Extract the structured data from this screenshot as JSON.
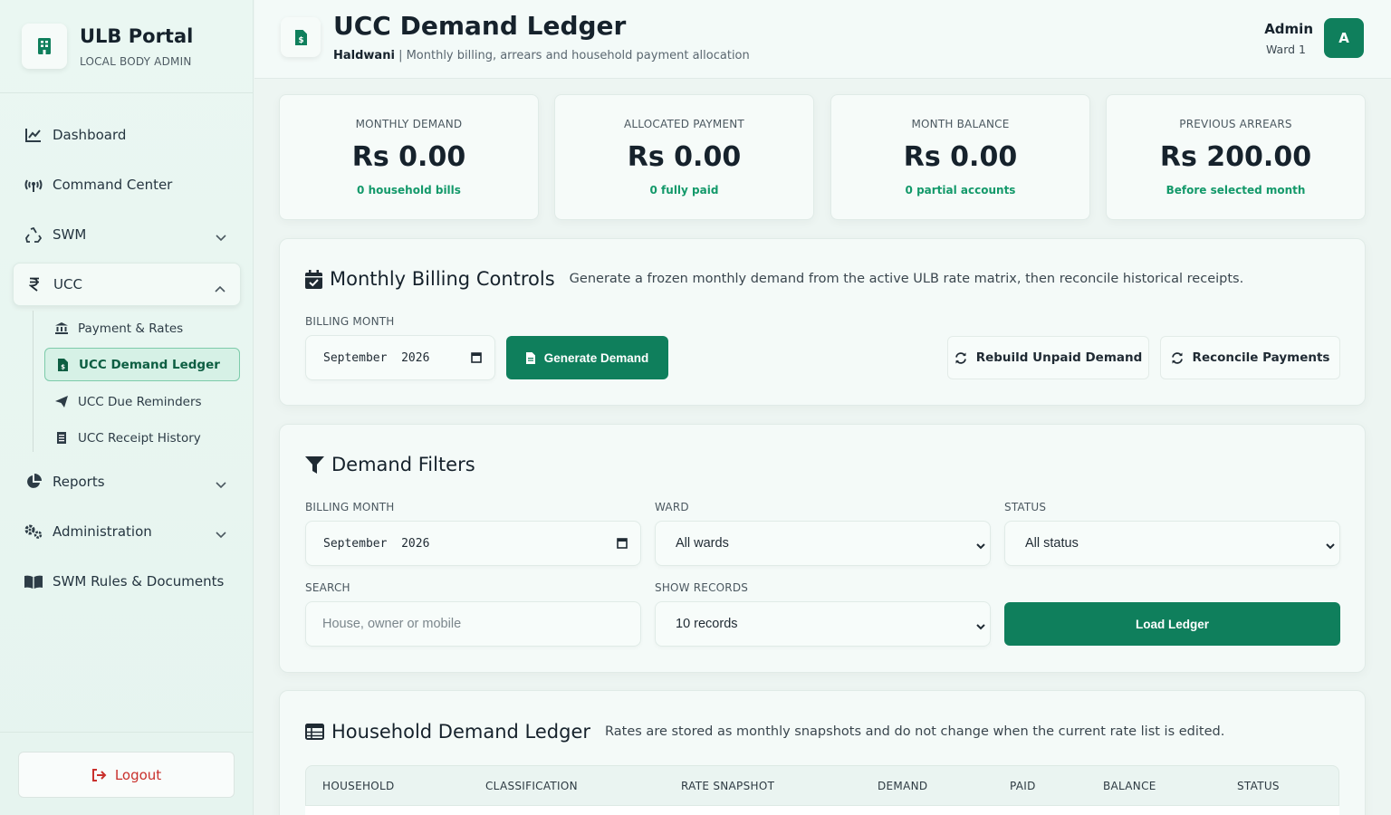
{
  "sidebar": {
    "brand_title": "ULB Portal",
    "brand_subtitle": "LOCAL BODY ADMIN",
    "nav": {
      "dashboard": "Dashboard",
      "command_center": "Command Center",
      "swm": "SWM",
      "ucc": "UCC",
      "reports": "Reports",
      "administration": "Administration",
      "swm_rules": "SWM Rules & Documents"
    },
    "ucc_sub": {
      "payment_rates": "Payment & Rates",
      "demand_ledger": "UCC Demand Ledger",
      "due_reminders": "UCC Due Reminders",
      "receipt_history": "UCC Receipt History"
    },
    "logout": "Logout"
  },
  "header": {
    "title": "UCC Demand Ledger",
    "city": "Haldwani",
    "subtitle": "| Monthly billing, arrears and household payment allocation",
    "user_name": "Admin",
    "user_role": "Ward 1",
    "avatar_letter": "A"
  },
  "stats": [
    {
      "label": "MONTHLY DEMAND",
      "value": "Rs 0.00",
      "note": "0 household bills"
    },
    {
      "label": "ALLOCATED PAYMENT",
      "value": "Rs 0.00",
      "note": "0 fully paid"
    },
    {
      "label": "MONTH BALANCE",
      "value": "Rs 0.00",
      "note": "0 partial accounts"
    },
    {
      "label": "PREVIOUS ARREARS",
      "value": "Rs 200.00",
      "note": "Before selected month"
    }
  ],
  "billing": {
    "title": "Monthly Billing Controls",
    "description": "Generate a frozen monthly demand from the active ULB rate matrix, then reconcile historical receipts.",
    "month_label": "BILLING MONTH",
    "month_value": "September  2026",
    "generate_label": "Generate Demand",
    "rebuild_label": "Rebuild Unpaid Demand",
    "reconcile_label": "Reconcile Payments"
  },
  "filters": {
    "title": "Demand Filters",
    "month_label": "BILLING MONTH",
    "month_value": "September  2026",
    "ward_label": "WARD",
    "ward_value": "All wards",
    "status_label": "STATUS",
    "status_value": "All status",
    "search_label": "SEARCH",
    "search_placeholder": "House, owner or mobile",
    "records_label": "SHOW RECORDS",
    "records_value": "10 records",
    "load_label": "Load Ledger"
  },
  "ledger": {
    "title": "Household Demand Ledger",
    "description": "Rates are stored as monthly snapshots and do not change when the current rate list is edited.",
    "columns": [
      "HOUSEHOLD",
      "CLASSIFICATION",
      "RATE SNAPSHOT",
      "DEMAND",
      "PAID",
      "BALANCE",
      "STATUS"
    ]
  },
  "colors": {
    "accent": "#0f7f5c",
    "positive_note": "#13996a",
    "logout": "#c9302c"
  }
}
